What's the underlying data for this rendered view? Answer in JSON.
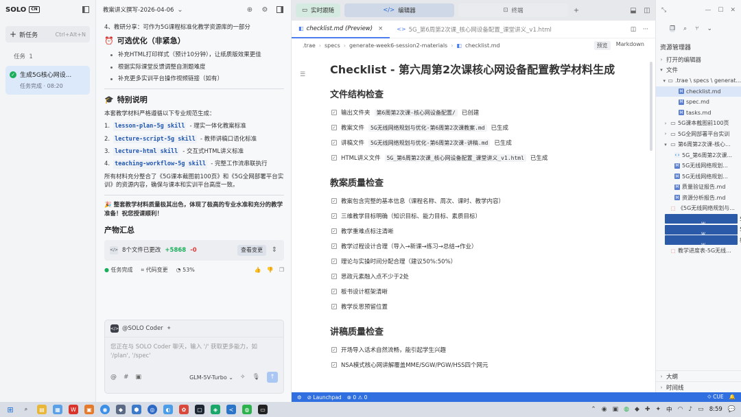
{
  "left": {
    "brand": "SOLO",
    "brand_badge": "CN",
    "new_task": "新任务",
    "new_task_shortcut": "Ctrl+Alt+N",
    "task_label": "任务",
    "task_count": "1",
    "task": {
      "title": "生成5G核心网设...",
      "status": "任务完成 · 08:20"
    }
  },
  "chat": {
    "title": "教案讲义撰写-2026-04-06",
    "line_top": "4、教研分享：可作为5G课程标准化教学资源库的一部分",
    "opt_heading": "可选优化（非紧急）",
    "opt_items": [
      "补充HTML打印样式（预计10分钟），让纸质版效果更佳",
      "根据实际课堂反馈调整自测题难度",
      "补充更多实训平台操作视频链接（如有）"
    ],
    "special_heading": "特别说明",
    "special_intro": "本套教学材料严格遵循以下专业规范生成：",
    "skills": [
      {
        "n": "1.",
        "code": "lesson-plan-5g skill",
        "desc": "- 理实一体化教案标准"
      },
      {
        "n": "2.",
        "code": "lecture-script-5g skill",
        "desc": "- 教师讲稿口语化标准"
      },
      {
        "n": "3.",
        "code": "lecture-html skill",
        "desc": "- 交互式HTML讲义标准"
      },
      {
        "n": "4.",
        "code": "teaching-workflow-5g skill",
        "desc": "- 完整工作流串联执行"
      }
    ],
    "integration": "所有材料充分整合了《5G课本截图前100页》和《5G全网部署平台实训》的资源内容，确保与课本和实训平台高度一致。",
    "praise": "整套教学材料质量极其出色，体现了极高的专业水准和充分的教学准备！祝您授课顺利！",
    "output_heading": "产物汇总",
    "summary": {
      "files": "8个文件已更改",
      "add": "+5868",
      "del": "-0",
      "view": "查看变更"
    },
    "status": {
      "done": "任务完成",
      "changes": "代码变更",
      "progress": "53%"
    },
    "input": {
      "agent": "@SOLO Coder",
      "placeholder": "您正在与 SOLO Coder 聊天，输入 '/' 获取更多能力，如 '/plan', '/spec'",
      "model": "GLM-5V-Turbo"
    }
  },
  "editor": {
    "top": {
      "live": "实时跟随",
      "editor": "编辑器",
      "terminal": "终端"
    },
    "tabs": [
      {
        "label": "checklist.md (Preview)",
        "active": true
      },
      {
        "label": "5G_第6周第2次课_核心网设备配置_课堂讲义_v1.html",
        "active": false
      }
    ],
    "crumb": [
      ".trae",
      "specs",
      "generate-week6-session2-materials",
      "checklist.md"
    ],
    "crumb_preview": "预览",
    "crumb_markdown": "Markdown",
    "doc": {
      "title": "Checklist - 第六周第2次课核心网设备配置教学材料生成",
      "sec1": "文件结构检查",
      "sec1_items": [
        {
          "pre": "输出文件夹",
          "code": "第6周第2次课-核心网设备配置/",
          "post": "已创建"
        },
        {
          "pre": "教案文件",
          "code": "5G无线网络规划与优化-第6周第2次课教案.md",
          "post": "已生成"
        },
        {
          "pre": "讲稿文件",
          "code": "5G无线网络规划与优化-第6周第2次课-讲稿.md",
          "post": "已生成"
        },
        {
          "pre": "HTML讲义文件",
          "code": "5G_第6周第2次课_核心网设备配置_课堂讲义_v1.html",
          "post": "已生成"
        }
      ],
      "sec2": "教案质量检查",
      "sec2_items": [
        "教案包含完整的基本信息（课程名称、周次、课时、教学内容）",
        "三维教学目标明确（知识目标、能力目标、素质目标）",
        "教学重难点标注清晰",
        "教学过程设计合理（导入→新课→练习→总结→作业）",
        "理论与实操时间分配合理（建议50%:50%）",
        "思政元素融入点不少于2处",
        "板书设计框架清晰",
        "教学反思预留位置"
      ],
      "sec3": "讲稿质量检查",
      "sec3_items": [
        "开场导入话术自然流畅，能引起学生兴趣",
        "NSA模式核心网讲解覆盖MME/SGW/PGW/HSS四个网元"
      ]
    },
    "statusbar": {
      "launchpad": "Launchpad",
      "errors": "0",
      "warnings": "0",
      "lang": "CUE"
    }
  },
  "explorer": {
    "title": "资源管理器",
    "open_editors": "打开的编辑器",
    "files": "文件",
    "tree": [
      {
        "label": ".trae \\ specs \\ generat...",
        "type": "folder",
        "indent": 1,
        "tri": "▾"
      },
      {
        "label": "checklist.md",
        "type": "md",
        "indent": 3,
        "sel": true
      },
      {
        "label": "spec.md",
        "type": "md",
        "indent": 3
      },
      {
        "label": "tasks.md",
        "type": "md",
        "indent": 3
      },
      {
        "label": "5G课本截图前100页",
        "type": "folder",
        "indent": 1,
        "tri": "›"
      },
      {
        "label": "5G全网部署平台实训",
        "type": "folder",
        "indent": 1,
        "tri": "›"
      },
      {
        "label": "第6周第2次课-核心...",
        "type": "folder",
        "indent": 1,
        "tri": "▾"
      },
      {
        "label": "5G_第6周第2次课...",
        "type": "code",
        "indent": 2
      },
      {
        "label": "5G无线网络规划...",
        "type": "md",
        "indent": 2
      },
      {
        "label": "5G无线网络规划...",
        "type": "md",
        "indent": 2
      },
      {
        "label": "质量验证报告.md",
        "type": "md",
        "indent": 2
      },
      {
        "label": "资源分析报告.md",
        "type": "md",
        "indent": 2
      },
      {
        "label": "《5G无线网络规划与...",
        "type": "pdf",
        "indent": 1
      },
      {
        "label": "5G无线网络规划与优...",
        "type": "doc",
        "indent": 1
      },
      {
        "label": "5G无线网络规划与优...",
        "type": "doc",
        "indent": 1
      },
      {
        "label": "教学进度表-5G无线...",
        "type": "doc",
        "indent": 1
      },
      {
        "label": "教学进度表-5G无线...",
        "type": "pdf",
        "indent": 1
      }
    ],
    "outline": "大纲",
    "timeline": "时间线"
  },
  "taskbar": {
    "ime": "中",
    "time": "8:59"
  }
}
